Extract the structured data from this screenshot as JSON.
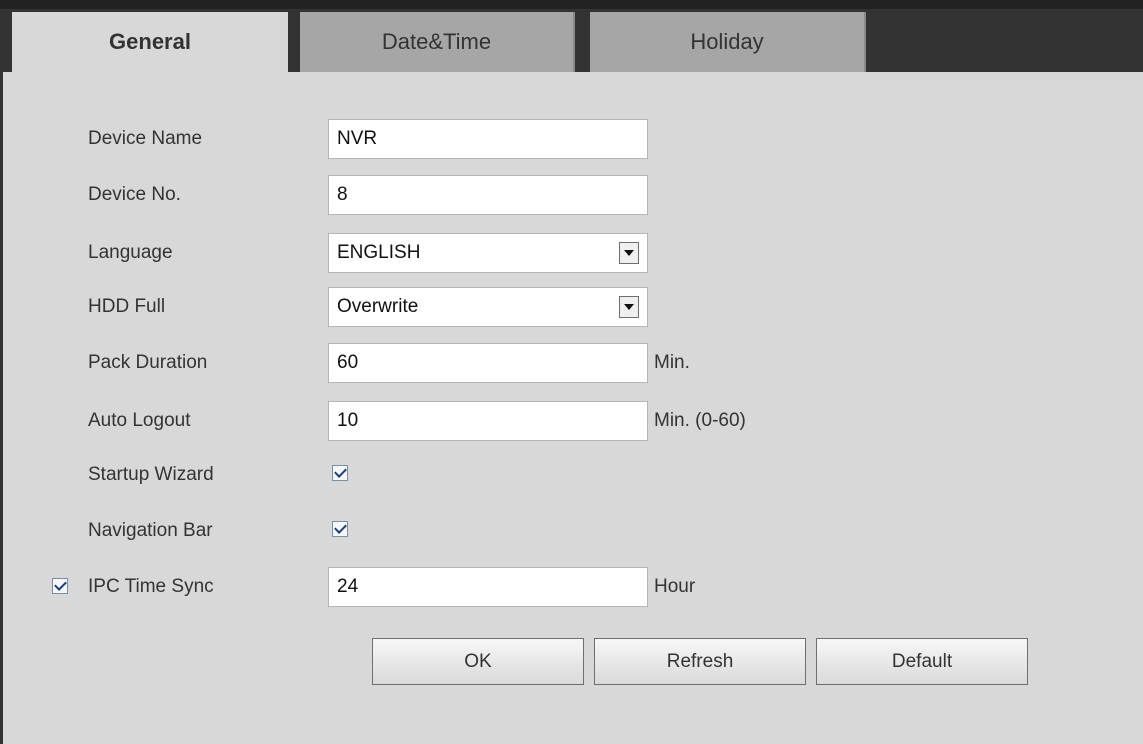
{
  "tabs": [
    {
      "label": "General",
      "active": true
    },
    {
      "label": "Date&Time",
      "active": false
    },
    {
      "label": "Holiday",
      "active": false
    }
  ],
  "form": {
    "device_name": {
      "label": "Device Name",
      "value": "NVR"
    },
    "device_no": {
      "label": "Device No.",
      "value": "8"
    },
    "language": {
      "label": "Language",
      "value": "ENGLISH"
    },
    "hdd_full": {
      "label": "HDD Full",
      "value": "Overwrite"
    },
    "pack_duration": {
      "label": "Pack Duration",
      "value": "60",
      "unit": "Min."
    },
    "auto_logout": {
      "label": "Auto Logout",
      "value": "10",
      "unit": "Min. (0-60)"
    },
    "startup_wizard": {
      "label": "Startup Wizard",
      "checked": true
    },
    "navigation_bar": {
      "label": "Navigation Bar",
      "checked": true
    },
    "ipc_time_sync": {
      "label": "IPC Time Sync",
      "checked": true,
      "value": "24",
      "unit": "Hour"
    }
  },
  "buttons": {
    "ok": "OK",
    "refresh": "Refresh",
    "default": "Default"
  },
  "colors": {
    "panel_bg": "#d8d8d8",
    "topbar_bg": "#333333",
    "inactive_tab_bg": "#a6a6a6"
  },
  "icons": {
    "dropdown": "chevron-down-icon",
    "checkbox": "checkmark-icon"
  }
}
